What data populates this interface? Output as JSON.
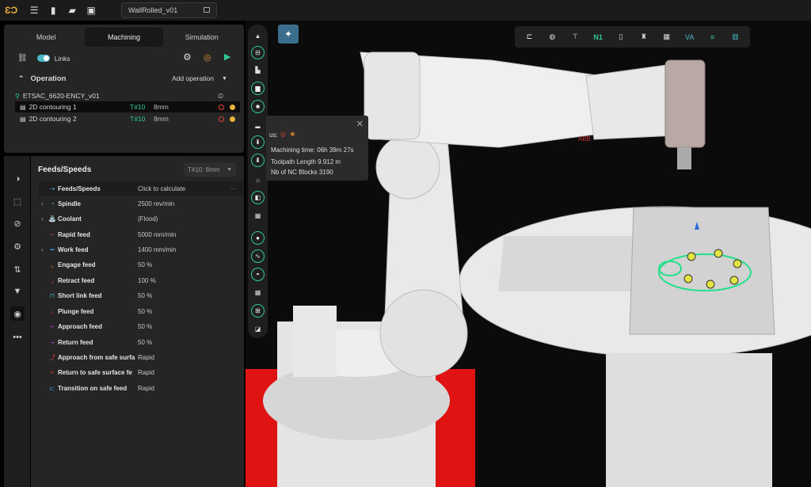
{
  "topbar": {
    "doc_title": "WallRolled_v01"
  },
  "tabs": [
    {
      "label": "Model"
    },
    {
      "label": "Machining"
    },
    {
      "label": "Simulation"
    }
  ],
  "links": {
    "label": "Links"
  },
  "operation": {
    "header": "Operation",
    "add_label": "Add operation",
    "group": "ETSAC_6620-ENCY_v01",
    "items": [
      {
        "name": "2D contouring 1",
        "tool": "T#10",
        "diameter": "8mm"
      },
      {
        "name": "2D contouring 2",
        "tool": "T#10",
        "diameter": "8mm"
      }
    ]
  },
  "feeds": {
    "title": "Feeds/Speeds",
    "tool_select": "T#10: 8mm",
    "rows": [
      {
        "label": "Feeds/Speeds",
        "value": "Click to calculate"
      },
      {
        "label": "Spindle",
        "value": "2500 rev/min"
      },
      {
        "label": "Coolant",
        "value": "(Flood)"
      },
      {
        "label": "Rapid feed",
        "value": "5000 mm/min"
      },
      {
        "label": "Work feed",
        "value": "1400 mm/min"
      },
      {
        "label": "Engage feed",
        "value": "50 %"
      },
      {
        "label": "Retract feed",
        "value": "100 %"
      },
      {
        "label": "Short link feed",
        "value": "50 %"
      },
      {
        "label": "Plunge feed",
        "value": "50 %"
      },
      {
        "label": "Approach feed",
        "value": "50 %"
      },
      {
        "label": "Return feed",
        "value": "50 %"
      },
      {
        "label": "Approach from safe surfa",
        "value": "Rapid"
      },
      {
        "label": "Return to safe surface fe",
        "value": "Rapid"
      },
      {
        "label": "Transition on safe feed",
        "value": "Rapid"
      }
    ]
  },
  "info": {
    "prefix": "us:",
    "time_label": "Machining time:",
    "time": "06h 39m 27s",
    "length_label": "Toolpath Length",
    "length": "9.912 m",
    "blocks_label": "Nb of NC Blocks",
    "blocks": "3190"
  },
  "toolbar_h": {
    "n1": "N1",
    "va": "VA"
  },
  "colors": {
    "accent": "#2fc79a",
    "red_floor": "#e11414",
    "panel": "#252525"
  }
}
